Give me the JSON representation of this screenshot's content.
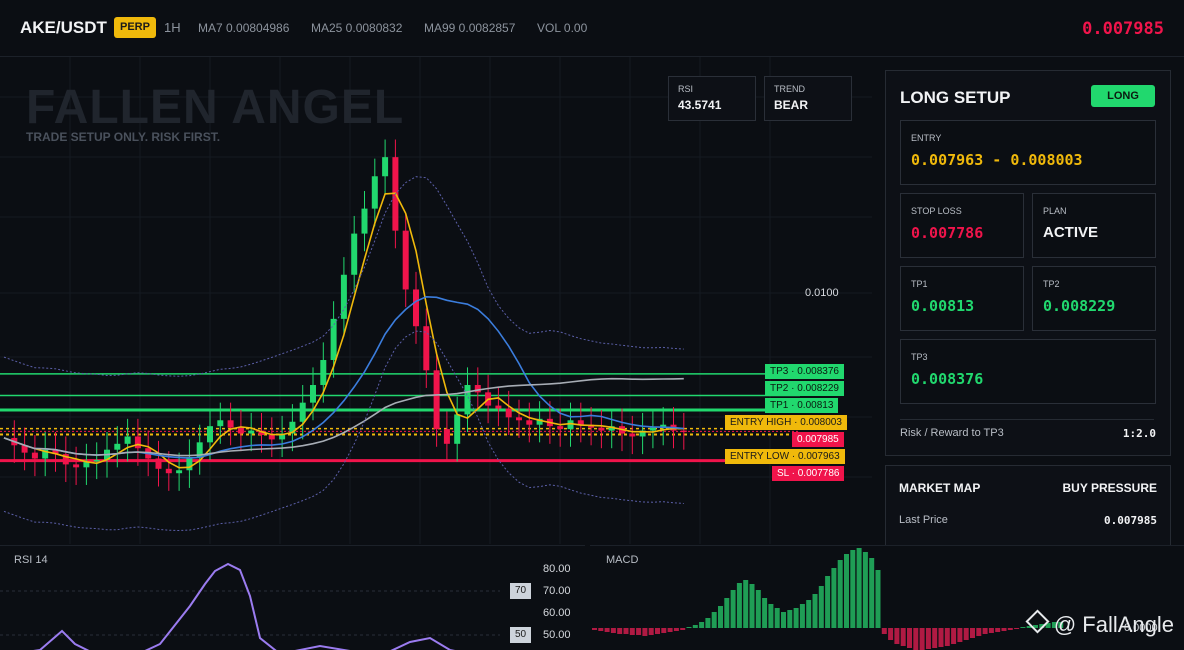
{
  "header": {
    "symbol": "AKE/USDT",
    "contract": "PERP",
    "timeframe": "1H",
    "ma7": "MA7 0.00804986",
    "ma25": "MA25 0.0080832",
    "ma99": "MA99 0.0082857",
    "vol": "VOL 0.00",
    "last_price": "0.007985"
  },
  "watermark": {
    "title": "FALLEN ANGEL",
    "subtitle": "TRADE SETUP ONLY. RISK FIRST."
  },
  "mini_stats": [
    {
      "label": "RSI",
      "value": "43.5741"
    },
    {
      "label": "TREND",
      "value": "BEAR"
    }
  ],
  "price_axis": {
    "tick": "0.0100"
  },
  "price_tags": {
    "tp3": "TP3 · 0.008376",
    "tp2": "TP2 · 0.008229",
    "tp1": "TP1 · 0.00813",
    "entry_high": "ENTRY HIGH · 0.008003",
    "last": "0.007985",
    "entry_low": "ENTRY LOW · 0.007963",
    "sl": "SL · 0.007786"
  },
  "setup": {
    "title": "LONG SETUP",
    "badge": "LONG",
    "entry": {
      "label": "ENTRY",
      "value": "0.007963 - 0.008003"
    },
    "stop_loss": {
      "label": "STOP LOSS",
      "value": "0.007786"
    },
    "plan": {
      "label": "PLAN",
      "value": "ACTIVE"
    },
    "tp1": {
      "label": "TP1",
      "value": "0.00813"
    },
    "tp2": {
      "label": "TP2",
      "value": "0.008229"
    },
    "tp3": {
      "label": "TP3",
      "value": "0.008376"
    },
    "risk_reward_label": "Risk / Reward to TP3",
    "risk_reward_value": "1:2.0"
  },
  "market_map": {
    "title": "MARKET MAP",
    "pressure": "BUY PRESSURE",
    "last_price_label": "Last Price",
    "last_price_value": "0.007985"
  },
  "rsi_pane": {
    "label": "RSI 14",
    "ticks": [
      "80.00",
      "60.00"
    ],
    "level70_tag": "70",
    "level70_value": "70.00",
    "level50_tag": "50",
    "level50_value": "50.00"
  },
  "macd_pane": {
    "label": "MACD",
    "tick": "0.0000"
  },
  "brand": "@ FallAngle",
  "colors": {
    "up": "#21d86e",
    "down": "#f0144b",
    "accent": "#f0b90b",
    "ma_blue": "#3b7ddd",
    "ma_yellow": "#f0b90b",
    "ma_gray": "#a7adb5",
    "rsi_line": "#9b7cf0"
  }
}
